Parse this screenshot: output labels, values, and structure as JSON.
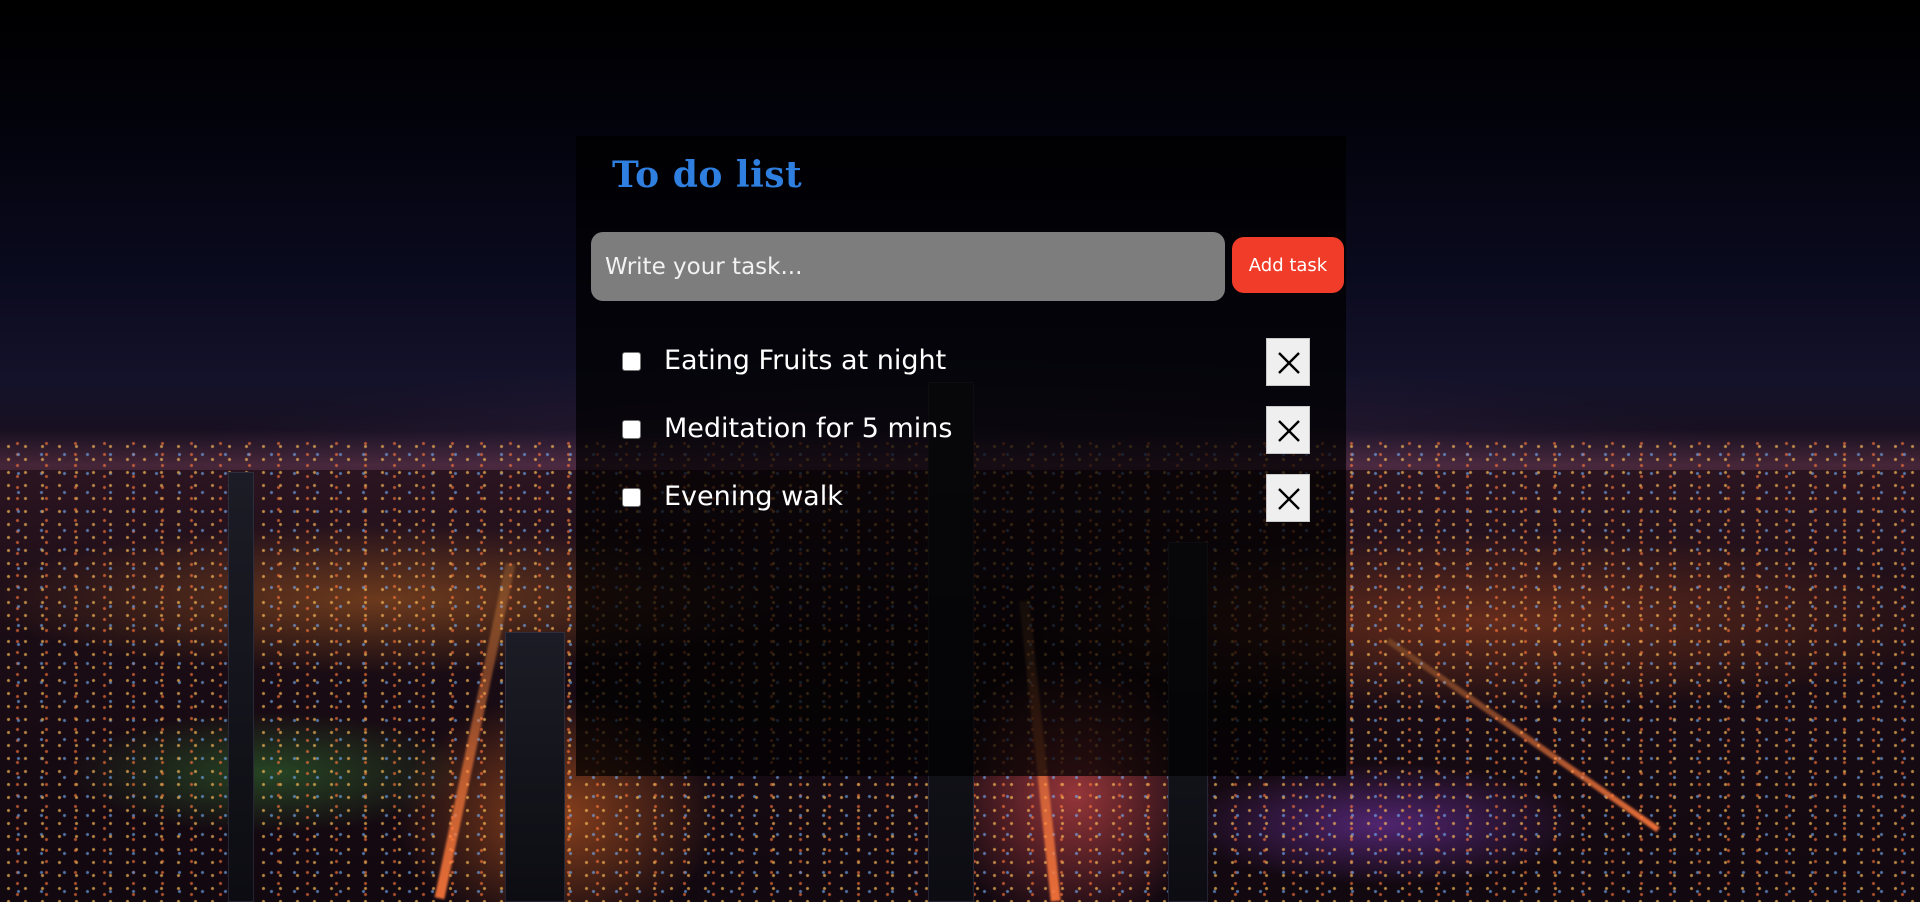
{
  "app": {
    "title": "To do list"
  },
  "input": {
    "placeholder": "Write your task...",
    "value": ""
  },
  "add_button": {
    "label": "Add task"
  },
  "tasks": [
    {
      "text": "Eating Fruits at night",
      "checked": false
    },
    {
      "text": "Meditation for 5 mins",
      "checked": false
    },
    {
      "text": "Evening walk",
      "checked": false
    }
  ],
  "icons": {
    "delete": "close-icon"
  },
  "colors": {
    "title": "#2f7fe0",
    "accent": "#f03c28",
    "input_bg": "#7d7d7d",
    "panel_bg": "rgba(0,0,0,0.72)"
  }
}
